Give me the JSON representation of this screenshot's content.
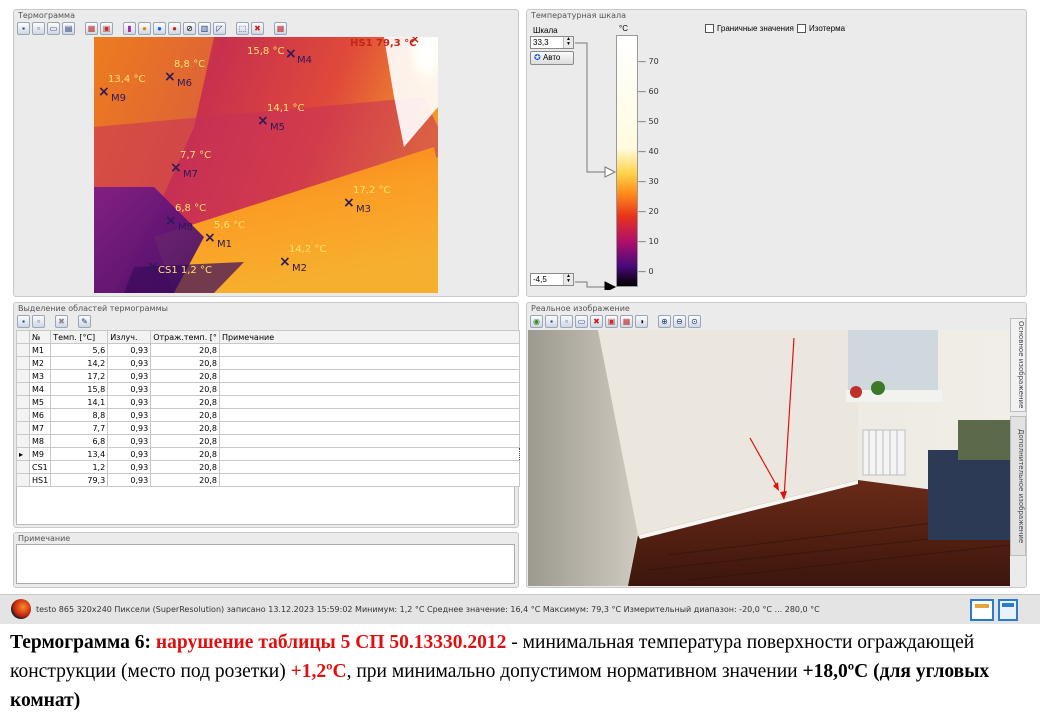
{
  "thermogram_panel": {
    "title": "Термограмма",
    "markers": [
      {
        "id": "HS1",
        "label": "HS1 79,3 °C"
      },
      {
        "id": "M4",
        "label": "M4",
        "value": "15,8 °C"
      },
      {
        "id": "M6",
        "label": "M6",
        "value": "8,8 °C"
      },
      {
        "id": "M9",
        "label": "M9",
        "value": "13,4 °C"
      },
      {
        "id": "M5",
        "label": "M5",
        "value": "14,1 °C"
      },
      {
        "id": "M7",
        "label": "M7",
        "value": "7,7 °C"
      },
      {
        "id": "M3",
        "label": "M3",
        "value": "17,2 °C"
      },
      {
        "id": "M8",
        "label": "M8",
        "value": "6,8 °C"
      },
      {
        "id": "M1",
        "label": "M1",
        "value": "5,6 °C"
      },
      {
        "id": "M2",
        "label": "M2",
        "value": "14,2 °C"
      },
      {
        "id": "CS1",
        "label": "CS1 1,2 °C"
      }
    ]
  },
  "scale_panel": {
    "title": "Температурная шкала",
    "scale_label": "Шкала",
    "max_value": "33,3",
    "min_value": "-4,5",
    "auto_button": "Авто",
    "unit": "°C",
    "ticks": [
      "70",
      "60",
      "50",
      "40",
      "30",
      "20",
      "10",
      "0"
    ],
    "boundary_values": "Граничные значения",
    "isotherm": "Изотерма"
  },
  "regions_panel": {
    "title": "Выделение областей термограммы",
    "columns": [
      "№",
      "Темп. [°C]",
      "Излуч.",
      "Отраж.темп. [°",
      "Примечание"
    ],
    "rows": [
      [
        "M1",
        "5,6",
        "0,93",
        "20,8"
      ],
      [
        "M2",
        "14,2",
        "0,93",
        "20,8"
      ],
      [
        "M3",
        "17,2",
        "0,93",
        "20,8"
      ],
      [
        "M4",
        "15,8",
        "0,93",
        "20,8"
      ],
      [
        "M5",
        "14,1",
        "0,93",
        "20,8"
      ],
      [
        "M6",
        "8,8",
        "0,93",
        "20,8"
      ],
      [
        "M7",
        "7,7",
        "0,93",
        "20,8"
      ],
      [
        "M8",
        "6,8",
        "0,93",
        "20,8"
      ],
      [
        "M9",
        "13,4",
        "0,93",
        "20,8"
      ],
      [
        "CS1",
        "1,2",
        "0,93",
        "20,8"
      ],
      [
        "HS1",
        "79,3",
        "0,93",
        "20,8"
      ]
    ]
  },
  "note_panel": {
    "title": "Примечание"
  },
  "photo_panel": {
    "title": "Реальное изображение",
    "tab_main": "Основное изображение",
    "tab_extra": "Дополнительное изображение"
  },
  "status_bar": {
    "text": "testo 865 320x240 Пиксели (SuperResolution) записано 13.12.2023 15:59:02 Минимум: 1,2 °C Среднее значение: 16,4 °C Максимум: 79,3 °C Измерительный диапазон: -20,0 °C ... 280,0 °C"
  },
  "caption": {
    "part1": "Термограмма  6: ",
    "part2": "нарушение таблицы 5 СП 50.13330.2012",
    "part3": " - минимальная температура поверхности ограждающей конструкции (место под розетки) ",
    "part4": "+1,2ºС",
    "part5": ", при минимально допустимом нормативном значении ",
    "part6": "+18,0ºС (для угловых комнат)"
  },
  "colors": {
    "accent_red": "#e01010",
    "panel_bg": "#ebebeb"
  }
}
